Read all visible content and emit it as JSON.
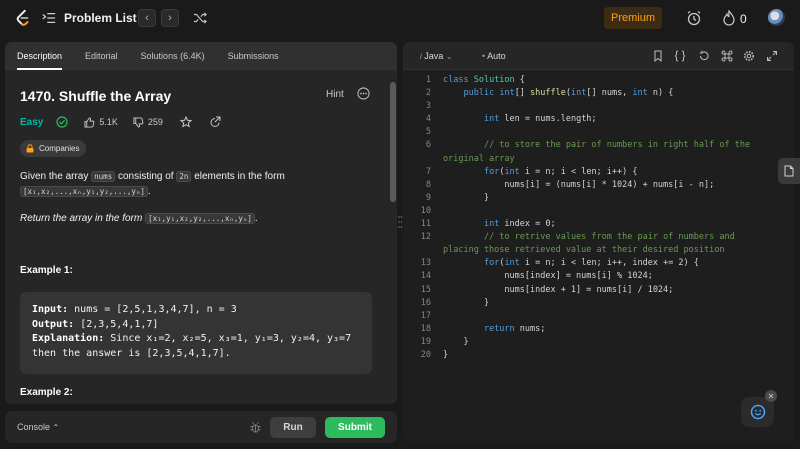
{
  "topbar": {
    "title": "Problem List",
    "prev_icon": "chevron-left-icon",
    "next_icon": "chevron-right-icon",
    "premium_label": "Premium",
    "streak_count": "0"
  },
  "tabs": [
    {
      "label": "Description"
    },
    {
      "label": "Editorial"
    },
    {
      "label": "Solutions (6.4K)"
    },
    {
      "label": "Submissions"
    }
  ],
  "problem": {
    "title": "1470. Shuffle the Array",
    "hint_label": "Hint",
    "difficulty": "Easy",
    "likes": "5.1K",
    "dislikes": "259",
    "companies_label": "Companies",
    "desc_given": "Given the array",
    "desc_nums": "nums",
    "desc_consisting": "consisting of",
    "desc_2n": "2n",
    "desc_elements": "elements in the form",
    "desc_form": "[x₁,x₂,...,xₙ,y₁,y₂,...,yₙ]",
    "desc_period": ".",
    "return_text": "Return the array in the form",
    "return_form": "[x₁,y₁,x₂,y₂,...,xₙ,yₙ]",
    "example1_title": "Example 1:",
    "example1_input_label": "Input:",
    "example1_input": "nums = [2,5,1,3,4,7], n = 3",
    "example1_output_label": "Output:",
    "example1_output": "[2,3,5,4,1,7]",
    "example1_expl_label": "Explanation:",
    "example1_expl_1": "Since x₁=2, x₂=5, x₃=1, y₁=3, y₂=4, y₃=7",
    "example1_expl_2": "then the answer is [2,3,5,4,1,7].",
    "example2_title": "Example 2:"
  },
  "console": {
    "label": "Console",
    "run_label": "Run",
    "submit_label": "Submit"
  },
  "editor": {
    "language": "Java",
    "mode": "Auto",
    "lines": [
      {
        "n": "1"
      },
      {
        "n": "2"
      },
      {
        "n": "3"
      },
      {
        "n": "4"
      },
      {
        "n": "5"
      },
      {
        "n": "6"
      },
      {
        "n": "7"
      },
      {
        "n": "8"
      },
      {
        "n": "9"
      },
      {
        "n": "10"
      },
      {
        "n": "11"
      },
      {
        "n": "12"
      },
      {
        "n": "13"
      },
      {
        "n": "14"
      },
      {
        "n": "15"
      },
      {
        "n": "16"
      },
      {
        "n": "17"
      },
      {
        "n": "18"
      },
      {
        "n": "19"
      },
      {
        "n": "20"
      }
    ]
  },
  "colors": {
    "accent_green": "#2cbb5d",
    "easy": "#00b8a3",
    "premium": "#ffa116"
  }
}
